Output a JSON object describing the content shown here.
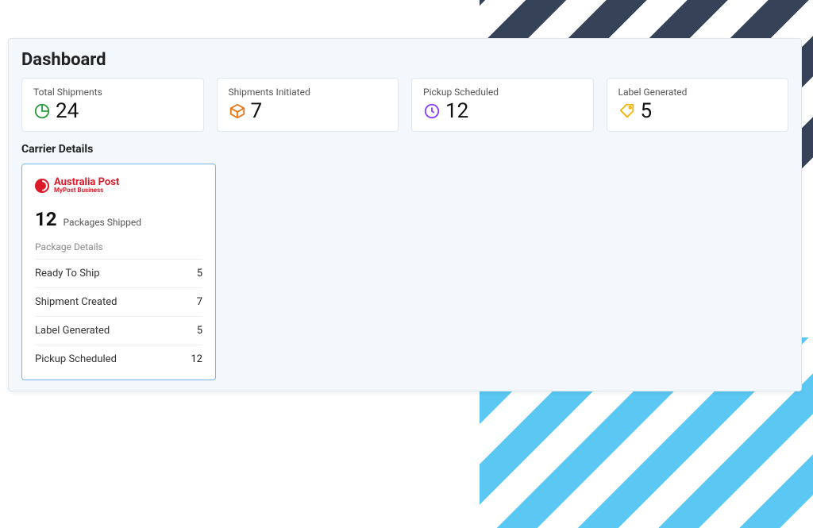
{
  "page_title": "Dashboard",
  "stats": {
    "total_shipments": {
      "label": "Total Shipments",
      "value": "24"
    },
    "shipments_initiated": {
      "label": "Shipments Initiated",
      "value": "7"
    },
    "pickup_scheduled": {
      "label": "Pickup Scheduled",
      "value": "12"
    },
    "label_generated": {
      "label": "Label Generated",
      "value": "5"
    }
  },
  "carrier_section_title": "Carrier Details",
  "carrier": {
    "logo_main": "Australia Post",
    "logo_sub": "MyPost Business",
    "packages_shipped": "12",
    "packages_shipped_caption": "Packages Shipped",
    "details_header": "Package Details",
    "rows": {
      "ready": {
        "label": "Ready To Ship",
        "value": "5"
      },
      "created": {
        "label": "Shipment Created",
        "value": "7"
      },
      "label": {
        "label": "Label Generated",
        "value": "5"
      },
      "pickup": {
        "label": "Pickup Scheduled",
        "value": "12"
      }
    }
  },
  "colors": {
    "icon_green": "#2e9b3f",
    "icon_orange": "#e77817",
    "icon_purple": "#8a3ffc",
    "icon_yellow": "#f5b40a"
  }
}
